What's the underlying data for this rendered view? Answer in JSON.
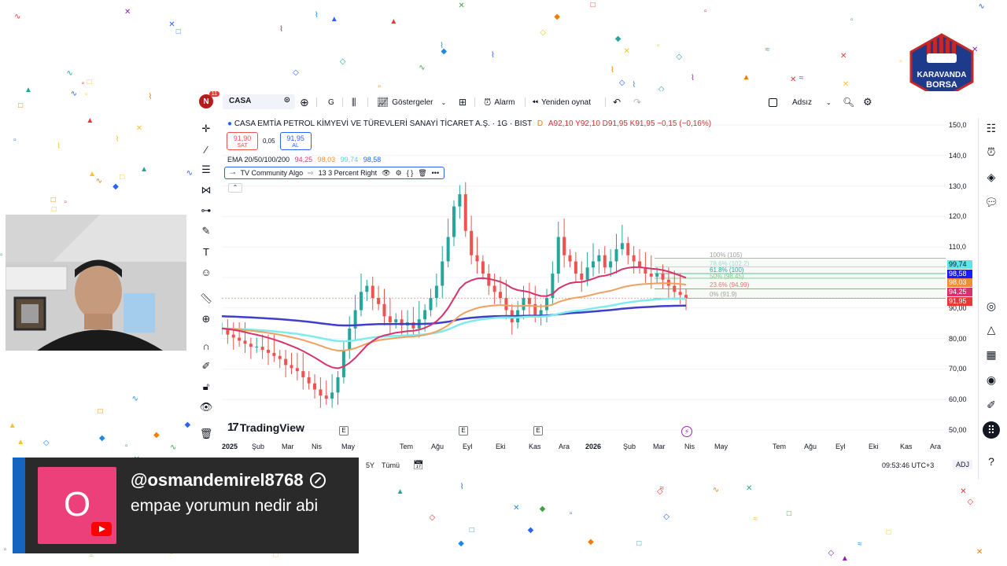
{
  "toolbar": {
    "avatar_letter": "N",
    "avatar_badge": "11",
    "symbol": "CASA",
    "interval": "G",
    "indicators_label": "Göstergeler",
    "alarm_label": "Alarm",
    "replay_label": "Yeniden oynat",
    "layout_name": "Adsız"
  },
  "legend": {
    "title": "CASA EMTİA PETROL KİMYEVİ VE TÜREVLERİ SANAYİ TİCARET A.Ş. · 1G · BIST",
    "d_flag": "D",
    "ohlc": "A92,10  Y92,10  D91,95  K91,95  −0,15 (−0,16%)"
  },
  "quote": {
    "sell_price": "91,90",
    "sell_label": "SAT",
    "spread": "0,05",
    "buy_price": "91,95",
    "buy_label": "AL"
  },
  "ema": {
    "label": "EMA 20/50/100/200",
    "v20": "94,25",
    "v50": "98,03",
    "v100": "99,74",
    "v200": "98,58",
    "colors": {
      "v20": "#d6336c",
      "v50": "#f08c3a",
      "v100": "#6fe6e6",
      "v200": "#2962ff"
    }
  },
  "algo": {
    "name": "TV Community Algo",
    "setting": "13 3 Percent Right"
  },
  "fib_labels": {
    "l100": "100% (105)",
    "l786": "78.6% (102.2)",
    "l618": "61.8% (100)",
    "l50": "50% (98.45)",
    "l236": "23.6% (94.99)",
    "l0": "0% (91.9)"
  },
  "price_axis": [
    "150,0",
    "140,0",
    "130,0",
    "120,0",
    "110,0",
    "100,0",
    "90,00",
    "80,00",
    "70,00",
    "60,00",
    "50,00"
  ],
  "price_tags": {
    "t1": "99,74",
    "t2": "98,58",
    "t3": "98,03",
    "t4": "94,25",
    "t5": "91,95"
  },
  "time_axis": [
    "2025",
    "Şub",
    "Mar",
    "Nis",
    "May",
    "Tem",
    "Ağu",
    "Eyl",
    "Eki",
    "Kas",
    "Ara",
    "2026",
    "Şub",
    "Mar",
    "Nis",
    "May",
    "Tem",
    "Ağu",
    "Eyl",
    "Eki",
    "Kas",
    "Ara"
  ],
  "brand": "TradingView",
  "event_marker": "E",
  "bottom": {
    "range_5y": "5Y",
    "range_all": "Tümü",
    "clock": "09:53:46 UTC+3",
    "adj": "ADJ"
  },
  "chat": {
    "avatar_letter": "O",
    "username": "@osmandemirel8768",
    "message": "empae yorumun nedir abi"
  },
  "logo": {
    "line1": "KARAVANDA",
    "line2": "BORSA"
  }
}
